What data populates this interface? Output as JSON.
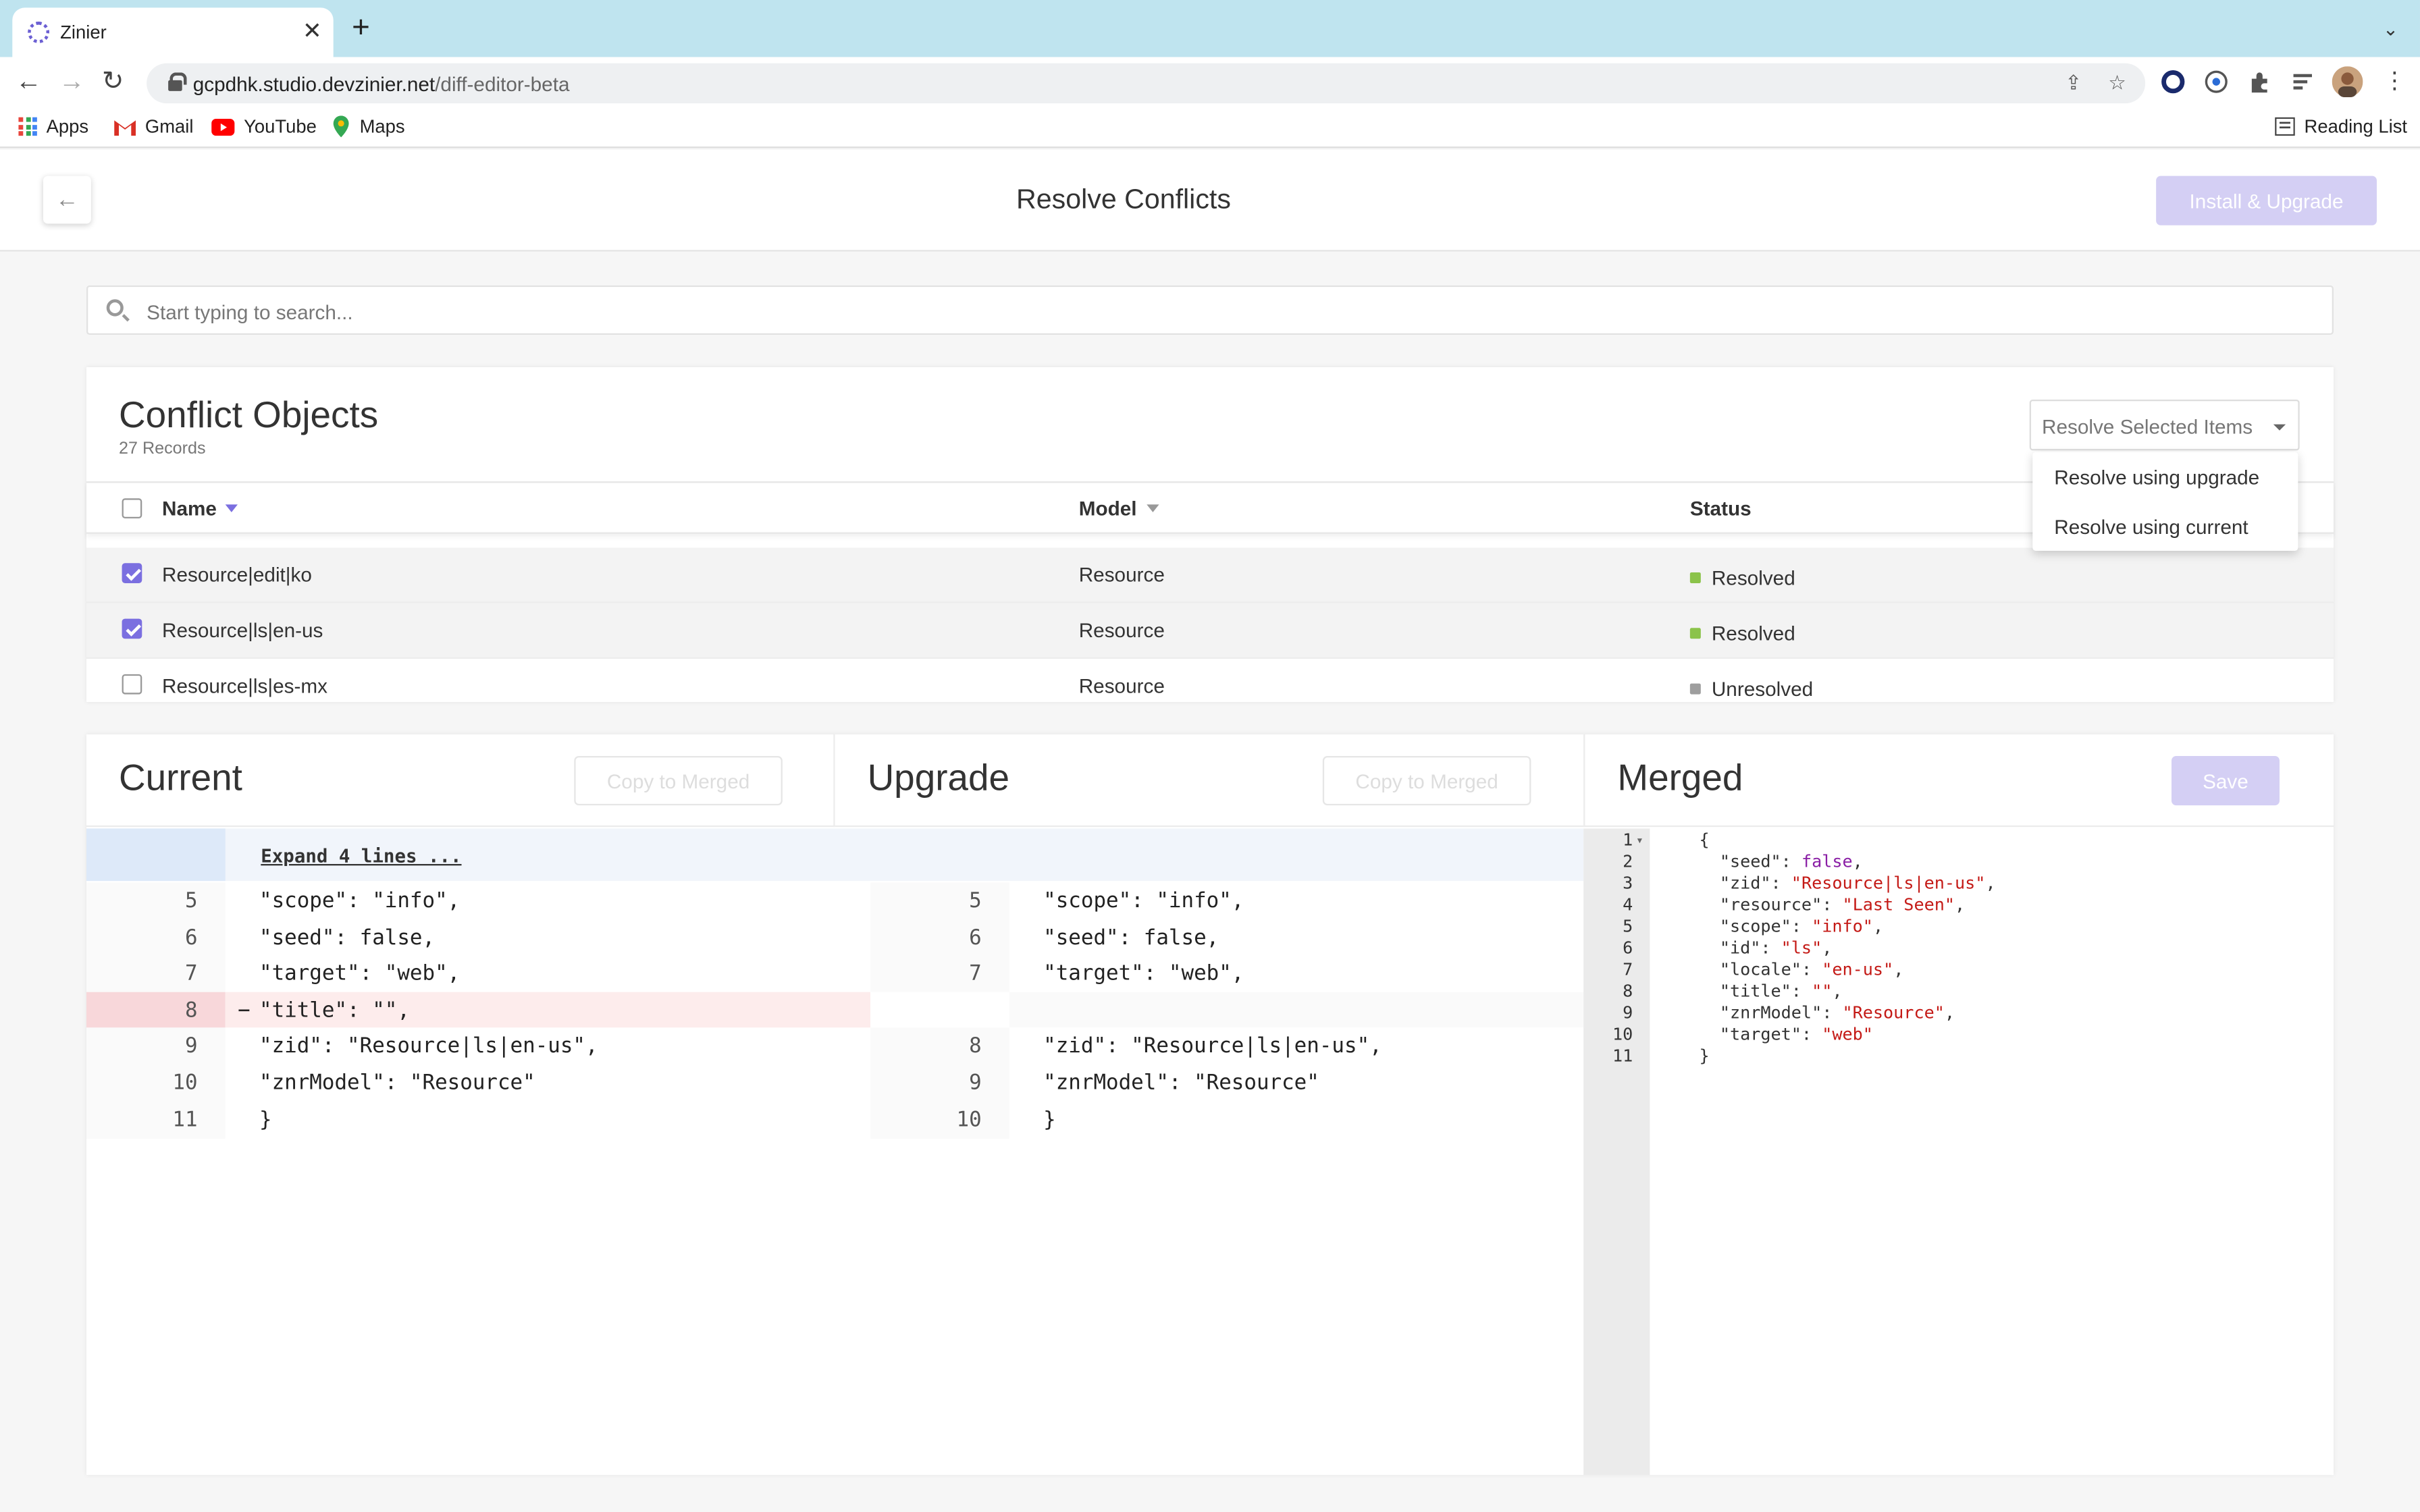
{
  "browser": {
    "tab_title": "Zinier",
    "url_host": "gcpdhk.studio.devzinier.net",
    "url_path": "/diff-editor-beta",
    "bookmarks": [
      "Apps",
      "Gmail",
      "YouTube",
      "Maps"
    ],
    "reading_list": "Reading List"
  },
  "header": {
    "title": "Resolve Conflicts",
    "install_label": "Install & Upgrade"
  },
  "search": {
    "placeholder": "Start typing to search..."
  },
  "conflicts": {
    "title": "Conflict Objects",
    "count": "27 Records",
    "resolve_select": "Resolve Selected Items",
    "dropdown": [
      "Resolve using upgrade",
      "Resolve using current"
    ],
    "columns": {
      "name": "Name",
      "model": "Model",
      "status": "Status"
    },
    "rows": [
      {
        "name": "Resource|edit|ko",
        "model": "Resource",
        "status": "Resolved",
        "checked": true
      },
      {
        "name": "Resource|ls|en-us",
        "model": "Resource",
        "status": "Resolved",
        "checked": true
      },
      {
        "name": "Resource|ls|es-mx",
        "model": "Resource",
        "status": "Unresolved",
        "checked": false
      }
    ],
    "status_colors": {
      "resolved": "#8bc34a",
      "unresolved": "#9e9e9e"
    }
  },
  "diff": {
    "current_title": "Current",
    "upgrade_title": "Upgrade",
    "merged_title": "Merged",
    "copy_label": "Copy to Merged",
    "save_label": "Save",
    "expand_label": "Expand 4 lines ...",
    "current_lines": [
      {
        "n": "5",
        "text": "\"scope\": \"info\","
      },
      {
        "n": "6",
        "text": "\"seed\": false,"
      },
      {
        "n": "7",
        "text": "\"target\": \"web\","
      },
      {
        "n": "8",
        "text": "\"title\": \"\",",
        "removed": true
      },
      {
        "n": "9",
        "text": "\"zid\": \"Resource|ls|en-us\","
      },
      {
        "n": "10",
        "text": "\"znrModel\": \"Resource\""
      },
      {
        "n": "11",
        "text": "}"
      }
    ],
    "upgrade_lines": [
      {
        "n": "5",
        "text": "\"scope\": \"info\","
      },
      {
        "n": "6",
        "text": "\"seed\": false,"
      },
      {
        "n": "7",
        "text": "\"target\": \"web\","
      },
      {
        "n": "",
        "text": "",
        "blank": true
      },
      {
        "n": "8",
        "text": "\"zid\": \"Resource|ls|en-us\","
      },
      {
        "n": "9",
        "text": "\"znrModel\": \"Resource\""
      },
      {
        "n": "10",
        "text": "}"
      }
    ],
    "merged_lines": [
      {
        "n": "1",
        "key": "{",
        "val": "",
        "type": "brace"
      },
      {
        "n": "2",
        "key": "  \"seed\": ",
        "val": "false",
        "type": "b",
        "tail": ","
      },
      {
        "n": "3",
        "key": "  \"zid\": ",
        "val": "\"Resource|ls|en-us\"",
        "type": "s",
        "tail": ","
      },
      {
        "n": "4",
        "key": "  \"resource\": ",
        "val": "\"Last Seen\"",
        "type": "s",
        "tail": ","
      },
      {
        "n": "5",
        "key": "  \"scope\": ",
        "val": "\"info\"",
        "type": "s",
        "tail": ","
      },
      {
        "n": "6",
        "key": "  \"id\": ",
        "val": "\"ls\"",
        "type": "s",
        "tail": ","
      },
      {
        "n": "7",
        "key": "  \"locale\": ",
        "val": "\"en-us\"",
        "type": "s",
        "tail": ","
      },
      {
        "n": "8",
        "key": "  \"title\": ",
        "val": "\"\"",
        "type": "s",
        "tail": ","
      },
      {
        "n": "9",
        "key": "  \"znrModel\": ",
        "val": "\"Resource\"",
        "type": "s",
        "tail": ","
      },
      {
        "n": "10",
        "key": "  \"target\": ",
        "val": "\"web\"",
        "type": "s",
        "tail": ""
      },
      {
        "n": "11",
        "key": "}",
        "val": "",
        "type": "brace"
      }
    ]
  },
  "colors": {
    "accent": "#7b6fe0",
    "accent_disabled": "#d4cff4",
    "removed_bg": "#fdecec",
    "removed_gutter": "#f8d7da"
  }
}
